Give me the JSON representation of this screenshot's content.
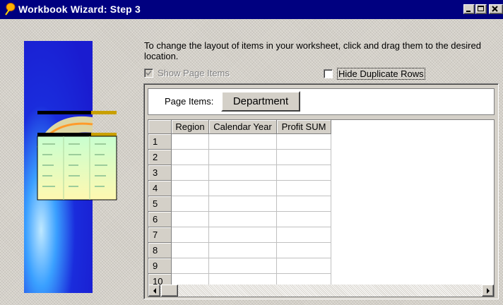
{
  "window": {
    "title": "Workbook Wizard: Step 3",
    "controls": [
      "minimize",
      "maximize",
      "close"
    ]
  },
  "instructions": "To change the layout of items in your worksheet, click and drag them to the desired location.",
  "options": {
    "show_page_items": {
      "label": "Show Page Items",
      "checked": true,
      "enabled": false
    },
    "hide_duplicate_rows": {
      "label": "Hide Duplicate Rows",
      "checked": false,
      "enabled": true
    }
  },
  "page_items": {
    "label": "Page Items:",
    "items": [
      "Department"
    ]
  },
  "grid": {
    "columns": [
      "Region",
      "Calendar Year",
      "Profit SUM"
    ],
    "rows": [
      "1",
      "2",
      "3",
      "4",
      "5",
      "6",
      "7",
      "8",
      "9",
      "10"
    ]
  },
  "icons": {
    "title_icon": "wizard-balloon-icon",
    "scroll_left": "arrow-left-icon",
    "scroll_right": "arrow-right-icon"
  },
  "colors": {
    "titlebar": "#000080",
    "art_blue": "#1a2cdc"
  }
}
